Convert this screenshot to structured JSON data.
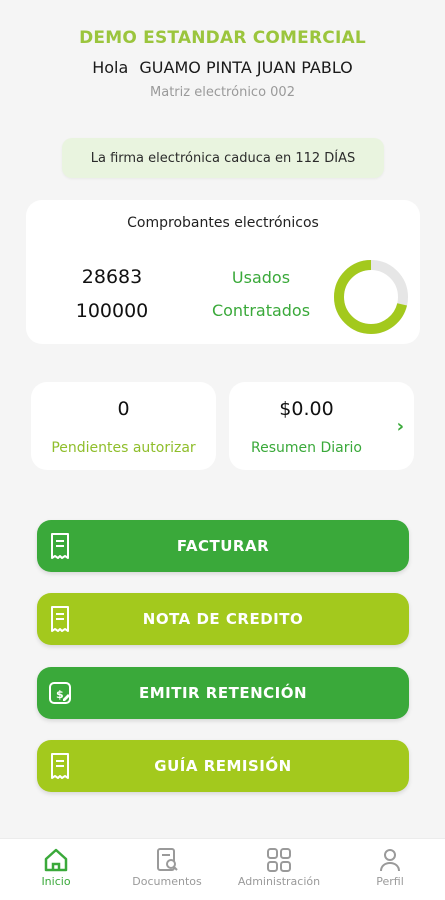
{
  "header": {
    "company": "DEMO ESTANDAR COMERCIAL",
    "greeting_prefix": "Hola",
    "user_name": "GUAMO PINTA JUAN PABLO",
    "matrix": "Matriz electrónico 002"
  },
  "alert": {
    "text": "La firma electrónica caduca en 112 DÍAS"
  },
  "comprobantes": {
    "title": "Comprobantes electrónicos",
    "used_value": "28683",
    "contracted_value": "100000",
    "used_label": "Usados",
    "contracted_label": "Contratados",
    "used_fraction": 0.28683
  },
  "pending": {
    "value": "0",
    "label": "Pendientes autorizar"
  },
  "daily": {
    "value": "$0.00",
    "label": "Resumen Diario"
  },
  "actions": [
    {
      "label": "FACTURAR",
      "icon": "receipt-icon"
    },
    {
      "label": "NOTA DE CREDITO",
      "icon": "receipt-icon"
    },
    {
      "label": "EMITIR RETENCIÓN",
      "icon": "money-edit-icon"
    },
    {
      "label": "GUÍA REMISIÓN",
      "icon": "receipt-icon"
    }
  ],
  "nav": [
    {
      "label": "Inicio",
      "icon": "home-icon",
      "active": true
    },
    {
      "label": "Documentos",
      "icon": "document-search-icon",
      "active": false
    },
    {
      "label": "Administración",
      "icon": "grid-icon",
      "active": false
    },
    {
      "label": "Perfil",
      "icon": "user-icon",
      "active": false
    }
  ],
  "colors": {
    "primary_green": "#3aa93a",
    "lime_green": "#a3c91d",
    "donut_track": "#e6e6e6",
    "alert_bg": "#e9f4df"
  }
}
